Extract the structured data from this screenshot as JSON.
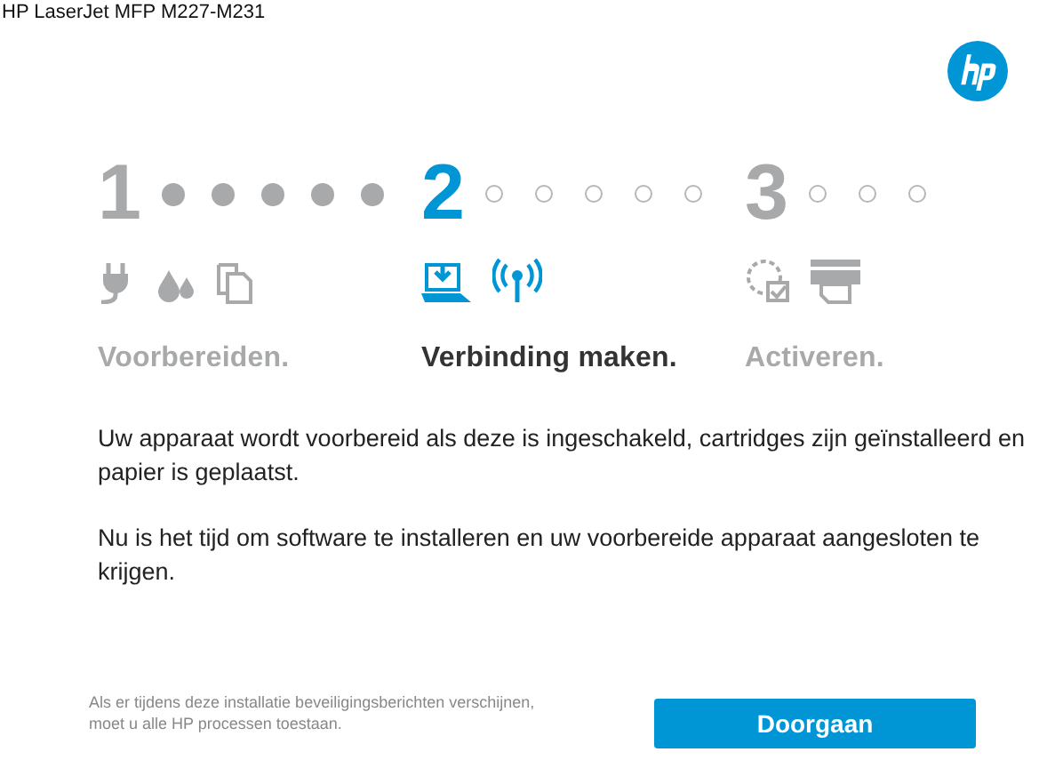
{
  "window": {
    "title": "HP LaserJet MFP M227-M231"
  },
  "steps": [
    {
      "number": "1",
      "completed": true,
      "selected": false,
      "label": "Voorbereiden.",
      "dots": [
        {
          "filled": true
        },
        {
          "filled": true
        },
        {
          "filled": true
        },
        {
          "filled": true
        },
        {
          "filled": true
        }
      ]
    },
    {
      "number": "2",
      "completed": false,
      "selected": true,
      "label": "Verbinding maken.",
      "dots": [
        {
          "filled": false
        },
        {
          "filled": false
        },
        {
          "filled": false
        },
        {
          "filled": false
        },
        {
          "filled": false
        }
      ]
    },
    {
      "number": "3",
      "completed": false,
      "selected": false,
      "label": "Activeren.",
      "dots": [
        {
          "filled": false
        },
        {
          "filled": false
        },
        {
          "filled": false
        }
      ]
    }
  ],
  "paragraphs": [
    "Uw apparaat wordt voorbereid als deze is ingeschakeld, cartridges zijn geïnstalleerd en papier is geplaatst.",
    "Nu is het tijd om software te installeren en uw voorbereide apparaat aangesloten te krijgen."
  ],
  "footer_note": "Als er tijdens deze installatie beveiligingsberichten verschijnen, moet u alle HP processen toestaan.",
  "continue_button": "Doorgaan"
}
